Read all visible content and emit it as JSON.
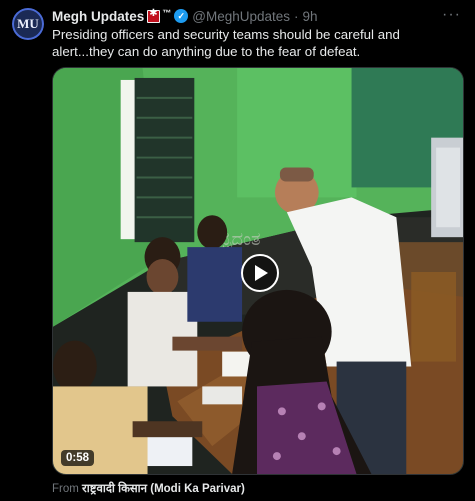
{
  "tweet": {
    "avatar_text": "MU",
    "author_name": "Megh Updates",
    "trademark": "™",
    "handle": "@MeghUpdates",
    "separator": "·",
    "time": "9h",
    "more_icon": "more-horizontal-icon",
    "text": "Presiding officers and security teams should be careful and alert...they can do anything due to the fear of defeat.",
    "media": {
      "type": "video",
      "duration": "0:58",
      "play_icon": "play-icon"
    },
    "from_label": "From",
    "from_source": "राष्ट्रवादी किसान (Modi Ka Parivar)"
  },
  "colors": {
    "background": "#000000",
    "text": "#e7e9ea",
    "muted": "#71767b",
    "verified": "#1d9bf0",
    "border": "#2f3336"
  }
}
